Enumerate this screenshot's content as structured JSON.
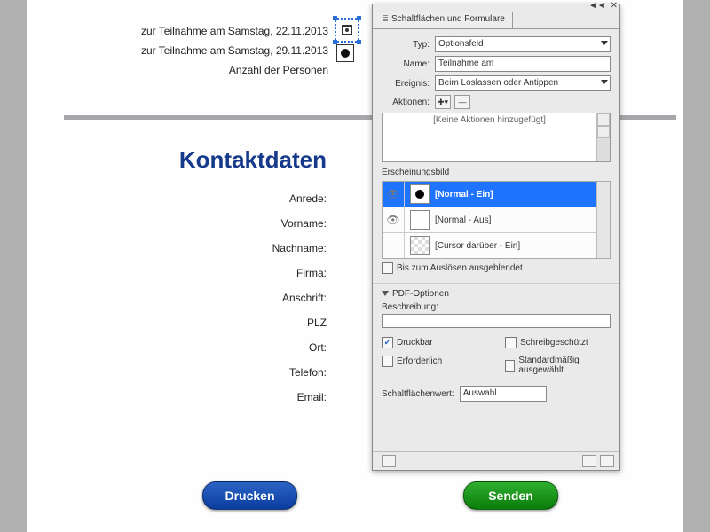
{
  "form": {
    "line1": "zur Teilnahme am Samstag, 22.11.2013",
    "line2": "zur Teilnahme am Samstag, 29.11.2013",
    "line3": "Anzahl der Personen",
    "heading": "Kontaktdaten",
    "labels": {
      "anrede": "Anrede:",
      "vorname": "Vorname:",
      "nachname": "Nachname:",
      "firma": "Firma:",
      "anschrift": "Anschrift:",
      "plz": "PLZ",
      "ort": "Ort:",
      "telefon": "Telefon:",
      "email": "Email:"
    }
  },
  "buttons": {
    "print": "Drucken",
    "send": "Senden"
  },
  "panel": {
    "title": "Schaltflächen und Formulare",
    "typ_label": "Typ:",
    "typ_value": "Optionsfeld",
    "name_label": "Name:",
    "name_value": "Teilnahme am",
    "ereignis_label": "Ereignis:",
    "ereignis_value": "Beim Loslassen oder Antippen",
    "aktionen_label": "Aktionen:",
    "aktionen_empty": "[Keine Aktionen hinzugefügt]",
    "erscheinungsbild": "Erscheinungsbild",
    "states": {
      "ein": "[Normal - Ein]",
      "aus": "[Normal - Aus]",
      "cursor": "[Cursor darüber - Ein]"
    },
    "bis_ausloesen": "Bis zum Auslösen ausgeblendet",
    "pdf_optionen": "PDF-Optionen",
    "beschreibung": "Beschreibung:",
    "druckbar": "Druckbar",
    "erforderlich": "Erforderlich",
    "schreibgeschuetzt": "Schreibgeschützt",
    "standard": "Standardmäßig ausgewählt",
    "schalt_label": "Schaltflächenwert:",
    "schalt_value": "Auswahl"
  }
}
